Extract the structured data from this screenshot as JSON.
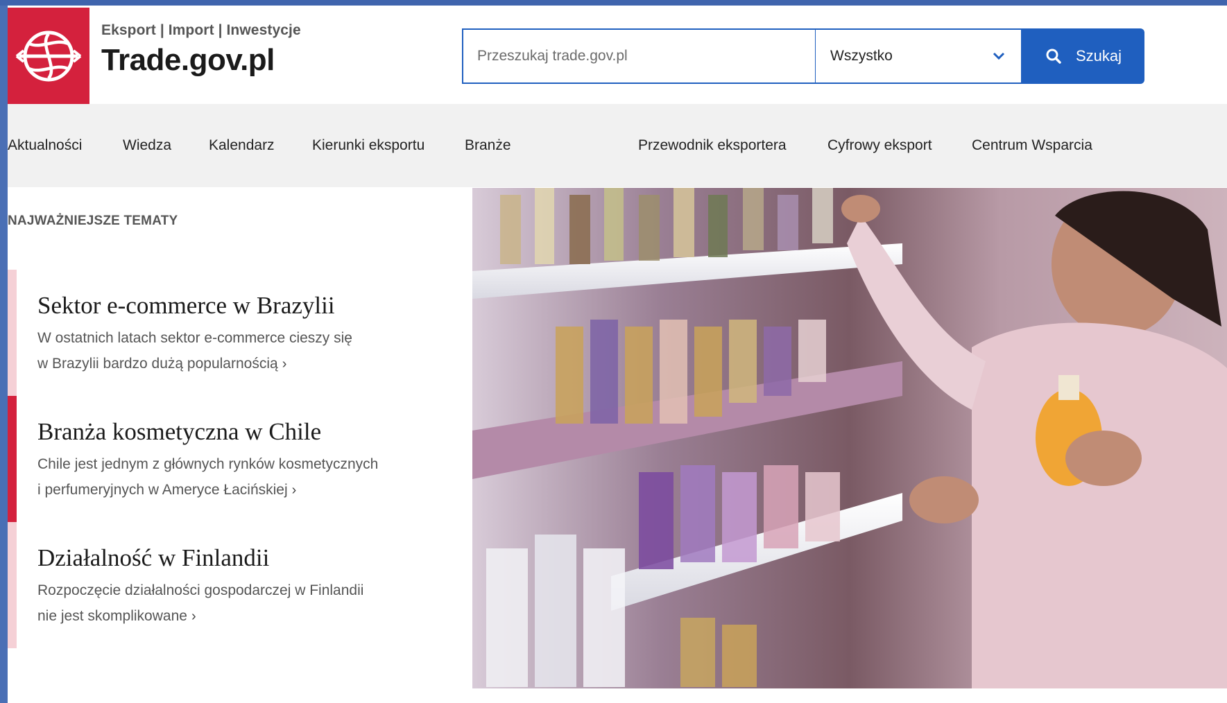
{
  "header": {
    "brand_tag": "Eksport | Import | Inwestycje",
    "brand_name": "Trade.gov.pl",
    "logo_icon": "globe-arrows-icon",
    "accent_color": "#d4213d"
  },
  "search": {
    "placeholder": "Przeszukaj trade.gov.pl",
    "value": "",
    "scope_selected": "Wszystko",
    "button_label": "Szukaj",
    "button_color": "#1f5fbf"
  },
  "nav": {
    "items": [
      {
        "label": "Aktualności"
      },
      {
        "label": "Wiedza"
      },
      {
        "label": "Kalendarz"
      },
      {
        "label": "Kierunki eksportu"
      },
      {
        "label": "Branże"
      },
      {
        "label": "Przewodnik eksportera"
      },
      {
        "label": "Cyfrowy eksport"
      },
      {
        "label": "Centrum Wsparcia"
      }
    ]
  },
  "topics": {
    "section_label": "NAJWAŻNIEJSZE TEMATY",
    "items": [
      {
        "title": "Sektor e-commerce w Brazylii",
        "desc_line1": "W ostatnich latach sektor e-commerce cieszy się",
        "desc_line2": "w Brazylii bardzo dużą popularnością"
      },
      {
        "title": "Branża kosmetyczna w Chile",
        "desc_line1": "Chile jest jednym z głównych rynków kosmetycznych",
        "desc_line2": "i perfumeryjnych w Ameryce Łacińskiej"
      },
      {
        "title": "Działalność w Finlandii",
        "desc_line1": "Rozpoczęcie działalności gospodarczej w Finlandii",
        "desc_line2": "nie jest skomplikowane"
      }
    ]
  },
  "hero": {
    "image_subject": "woman-shopping-perfume-photo"
  }
}
